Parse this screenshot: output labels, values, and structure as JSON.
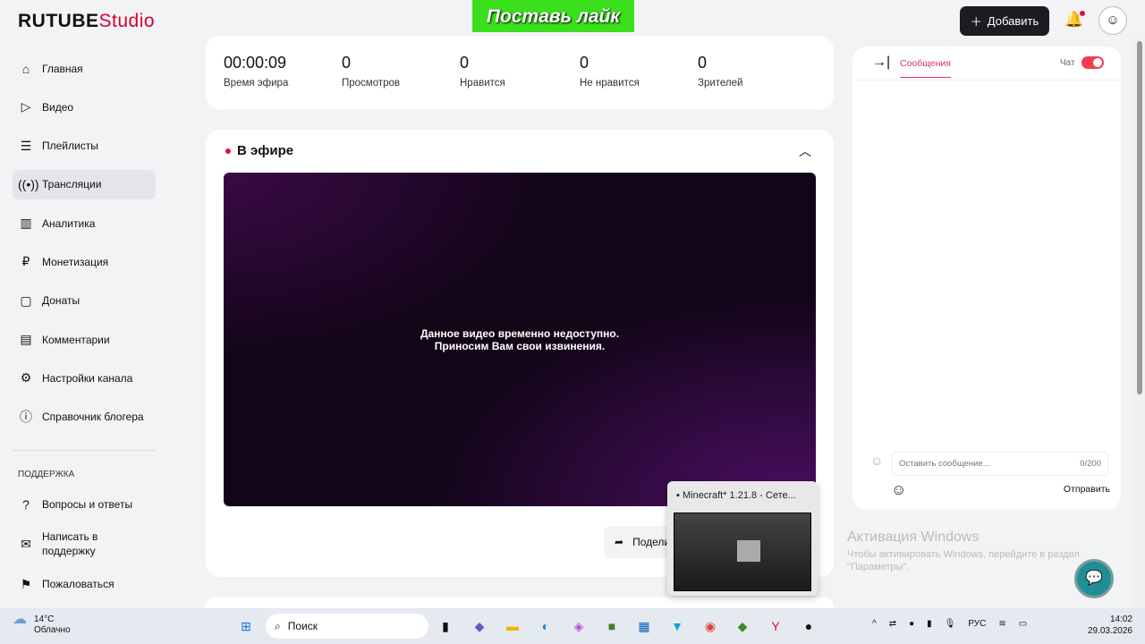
{
  "header": {
    "logo_main": "RUTUBE",
    "logo_sub": "Studio",
    "promo": "Поставь лайк",
    "add_label": "Добавить"
  },
  "sidebar": {
    "items": [
      {
        "label": "Главная",
        "icon": "home-icon"
      },
      {
        "label": "Видео",
        "icon": "video-icon"
      },
      {
        "label": "Плейлисты",
        "icon": "playlist-icon"
      },
      {
        "label": "Трансляции",
        "icon": "broadcast-icon",
        "active": true
      },
      {
        "label": "Аналитика",
        "icon": "chart-icon"
      },
      {
        "label": "Монетизация",
        "icon": "ruble-icon"
      },
      {
        "label": "Донаты",
        "icon": "donate-icon"
      },
      {
        "label": "Комментарии",
        "icon": "comment-icon"
      },
      {
        "label": "Настройки канала",
        "icon": "gear-icon"
      },
      {
        "label": "Справочник блогера",
        "icon": "info-icon"
      }
    ],
    "support_title": "ПОДДЕРЖКА",
    "support_items": [
      {
        "label": "Вопросы и ответы"
      },
      {
        "label": "Написать в поддержку"
      },
      {
        "label": "Пожаловаться"
      }
    ]
  },
  "stats": [
    {
      "value": "00:00:09",
      "label": "Время эфира"
    },
    {
      "value": "0",
      "label": "Просмотров"
    },
    {
      "value": "0",
      "label": "Нравится"
    },
    {
      "value": "0",
      "label": "Не нравится"
    },
    {
      "value": "0",
      "label": "Зрителей"
    }
  ],
  "live": {
    "title": "В эфире",
    "msg1": "Данное видео временно недоступно.",
    "msg2": "Приносим Вам свои извинения.",
    "share": "Поделиться"
  },
  "chat": {
    "tab": "Сообщения",
    "chat_label": "Чат",
    "placeholder": "Оставить сообщение...",
    "counter": "0/200",
    "send": "Отправить"
  },
  "popup": {
    "title": "Minecraft* 1.21.8 - Сете..."
  },
  "windows": {
    "title": "Активация Windows",
    "text": "Чтобы активировать Windows, перейдите в раздел \"Параметры\"."
  },
  "taskbar": {
    "temp": "14°C",
    "weather": "Облачно",
    "search": "Поиск",
    "lang": "РУС",
    "time": "14:02",
    "date": "29.03.2026"
  }
}
